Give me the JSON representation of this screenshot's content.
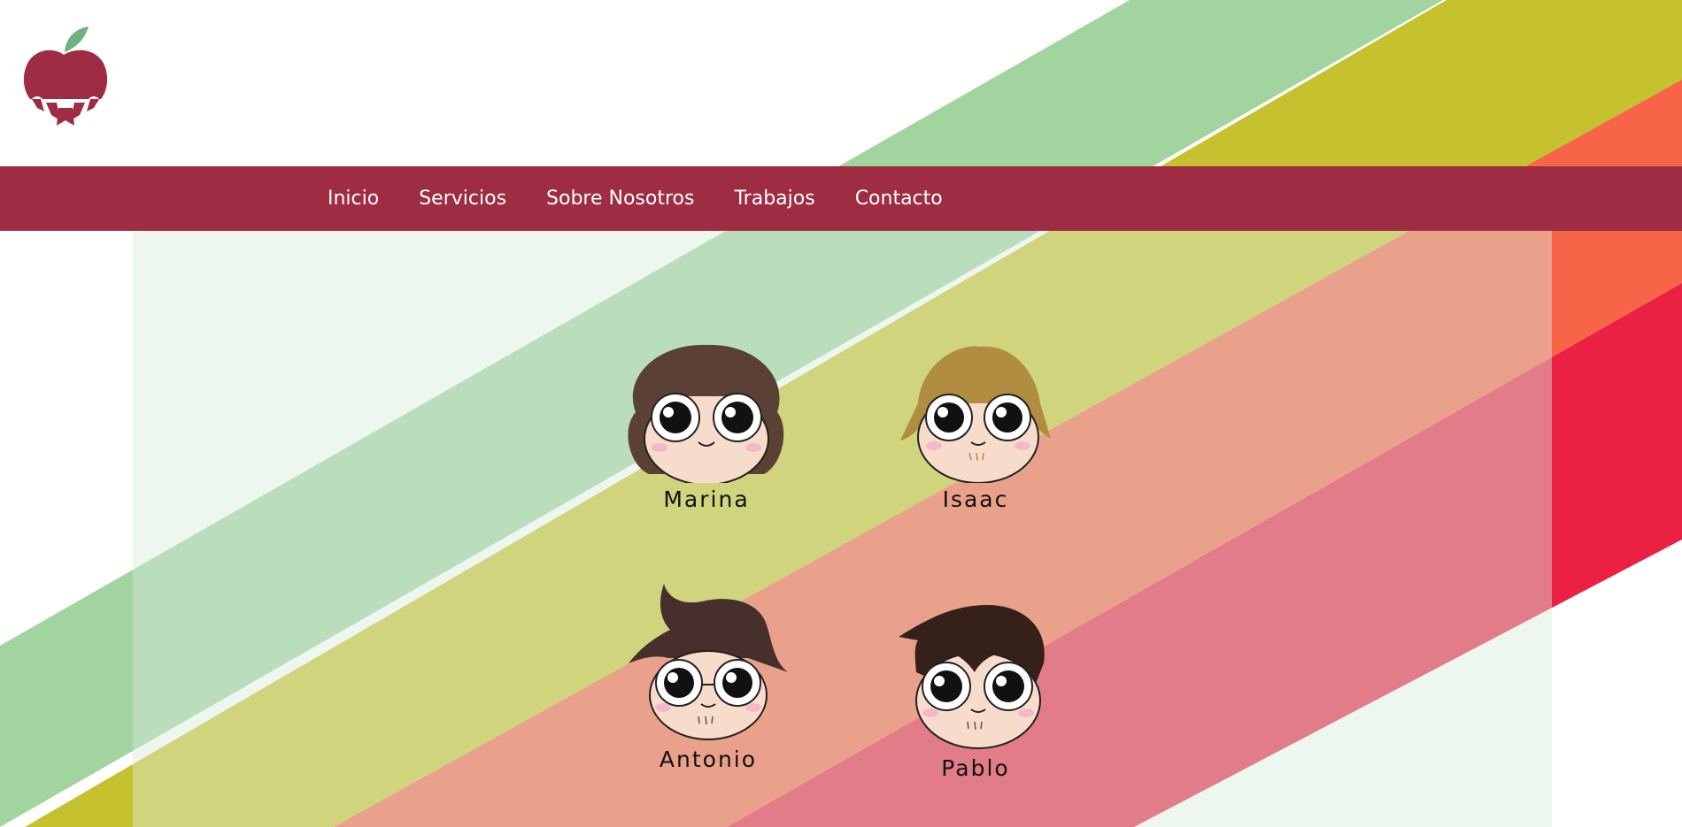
{
  "brand": {
    "logo_icon": "apple-people-logo-icon",
    "color": "#9e2c43",
    "leaf_color": "#6fb182"
  },
  "nav": {
    "items": [
      {
        "label": "Inicio"
      },
      {
        "label": "Servicios"
      },
      {
        "label": "Sobre Nosotros"
      },
      {
        "label": "Trabajos"
      },
      {
        "label": "Contacto"
      }
    ]
  },
  "team": {
    "members": [
      {
        "name": "Marina",
        "avatar": "marina-avatar-icon",
        "hair_color": "#5b4035"
      },
      {
        "name": "Isaac",
        "avatar": "isaac-avatar-icon",
        "hair_color": "#b18d3f"
      },
      {
        "name": "Antonio",
        "avatar": "antonio-avatar-icon",
        "hair_color": "#47302c"
      },
      {
        "name": "Pablo",
        "avatar": "pablo-avatar-icon",
        "hair_color": "#35201a"
      }
    ]
  },
  "colors": {
    "stripe_green": "#a1d49f",
    "stripe_olive": "#c6c12f",
    "stripe_orange": "#f76447",
    "stripe_red": "#ea2142",
    "panel_tint": "#dceee0"
  }
}
